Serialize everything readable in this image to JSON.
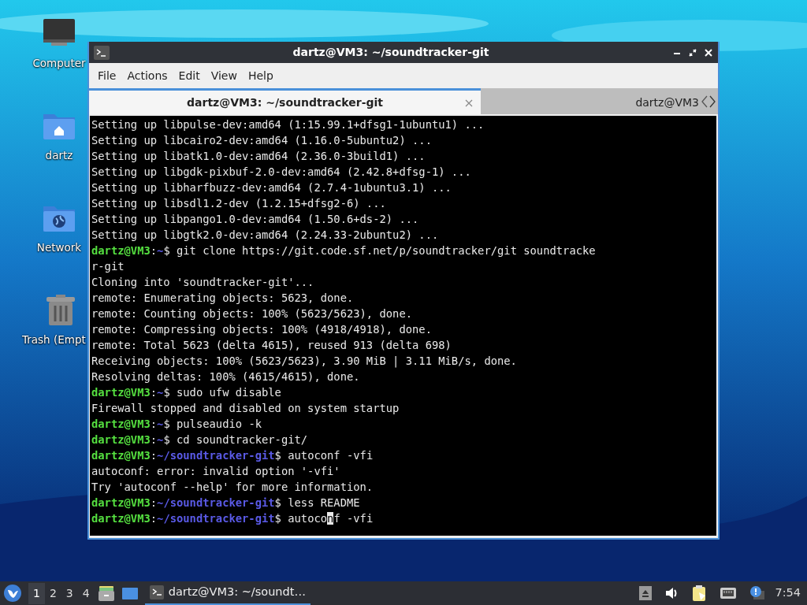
{
  "desktop": {
    "icons": [
      {
        "label": "Computer",
        "kind": "computer"
      },
      {
        "label": "dartz",
        "kind": "home"
      },
      {
        "label": "Network",
        "kind": "network"
      },
      {
        "label": "Trash (Empt",
        "kind": "trash"
      }
    ]
  },
  "window": {
    "title": "dartz@VM3: ~/soundtracker-git",
    "menu": [
      "File",
      "Actions",
      "Edit",
      "View",
      "Help"
    ],
    "tabs": [
      {
        "label": "dartz@VM3: ~/soundtracker-git",
        "selected": true,
        "closable": true
      },
      {
        "label": "dartz@VM3",
        "selected": false,
        "closable": false
      }
    ],
    "terminal": {
      "lines": [
        {
          "kind": "output",
          "text": "Setting up libpulse-dev:amd64 (1:15.99.1+dfsg1-1ubuntu1) ..."
        },
        {
          "kind": "output",
          "text": "Setting up libcairo2-dev:amd64 (1.16.0-5ubuntu2) ..."
        },
        {
          "kind": "output",
          "text": "Setting up libatk1.0-dev:amd64 (2.36.0-3build1) ..."
        },
        {
          "kind": "output",
          "text": "Setting up libgdk-pixbuf-2.0-dev:amd64 (2.42.8+dfsg-1) ..."
        },
        {
          "kind": "output",
          "text": "Setting up libharfbuzz-dev:amd64 (2.7.4-1ubuntu3.1) ..."
        },
        {
          "kind": "output",
          "text": "Setting up libsdl1.2-dev (1.2.15+dfsg2-6) ..."
        },
        {
          "kind": "output",
          "text": "Setting up libpango1.0-dev:amd64 (1.50.6+ds-2) ..."
        },
        {
          "kind": "output",
          "text": "Setting up libgtk2.0-dev:amd64 (2.24.33-2ubuntu2) ..."
        },
        {
          "kind": "prompt",
          "user": "dartz@VM3",
          "sep": ":",
          "path": "~",
          "dollar": "$",
          "command": " git clone https://git.code.sf.net/p/soundtracker/git soundtracke"
        },
        {
          "kind": "output",
          "text": "r-git"
        },
        {
          "kind": "output",
          "text": "Cloning into 'soundtracker-git'..."
        },
        {
          "kind": "output",
          "text": "remote: Enumerating objects: 5623, done."
        },
        {
          "kind": "output",
          "text": "remote: Counting objects: 100% (5623/5623), done."
        },
        {
          "kind": "output",
          "text": "remote: Compressing objects: 100% (4918/4918), done."
        },
        {
          "kind": "output",
          "text": "remote: Total 5623 (delta 4615), reused 913 (delta 698)"
        },
        {
          "kind": "output",
          "text": "Receiving objects: 100% (5623/5623), 3.90 MiB | 3.11 MiB/s, done."
        },
        {
          "kind": "output",
          "text": "Resolving deltas: 100% (4615/4615), done."
        },
        {
          "kind": "prompt",
          "user": "dartz@VM3",
          "sep": ":",
          "path": "~",
          "dollar": "$",
          "command": " sudo ufw disable"
        },
        {
          "kind": "output",
          "text": "Firewall stopped and disabled on system startup"
        },
        {
          "kind": "prompt",
          "user": "dartz@VM3",
          "sep": ":",
          "path": "~",
          "dollar": "$",
          "command": " pulseaudio -k"
        },
        {
          "kind": "prompt",
          "user": "dartz@VM3",
          "sep": ":",
          "path": "~",
          "dollar": "$",
          "command": " cd soundtracker-git/"
        },
        {
          "kind": "prompt",
          "user": "dartz@VM3",
          "sep": ":",
          "path": "~/soundtracker-git",
          "dollar": "$",
          "command": " autoconf -vfi"
        },
        {
          "kind": "output",
          "text": "autoconf: error: invalid option '-vfi'"
        },
        {
          "kind": "output",
          "text": "Try 'autoconf --help' for more information."
        },
        {
          "kind": "prompt",
          "user": "dartz@VM3",
          "sep": ":",
          "path": "~/soundtracker-git",
          "dollar": "$",
          "command": " less README"
        },
        {
          "kind": "prompt",
          "user": "dartz@VM3",
          "sep": ":",
          "path": "~/soundtracker-git",
          "dollar": "$",
          "command": " autoco",
          "cursor": "n",
          "command_after": "f -vfi"
        }
      ]
    }
  },
  "taskbar": {
    "workspaces": [
      {
        "label": "1",
        "selected": true
      },
      {
        "label": "2",
        "selected": false
      },
      {
        "label": "3",
        "selected": false
      },
      {
        "label": "4",
        "selected": false
      }
    ],
    "tasks": [
      {
        "label": "dartz@VM3: ~/soundt…",
        "selected": true
      }
    ],
    "clock": "7:54"
  }
}
